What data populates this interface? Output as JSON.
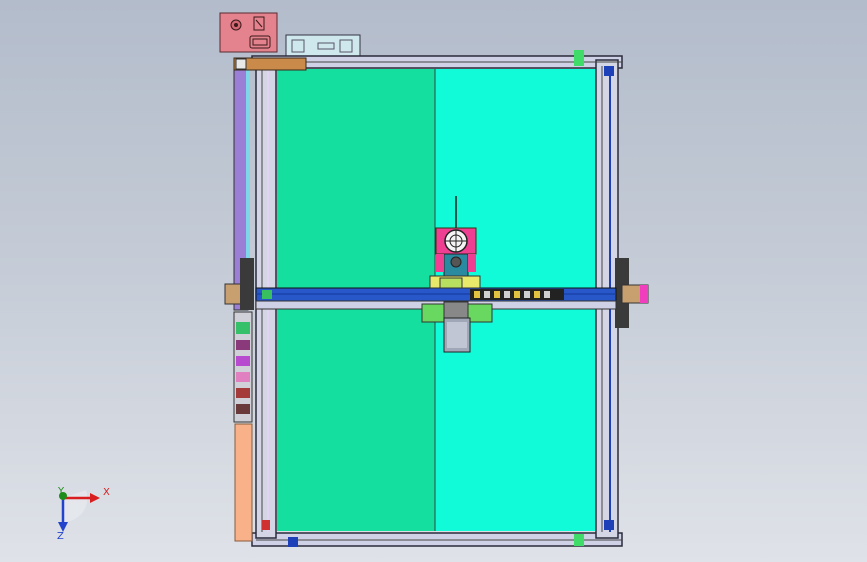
{
  "colors": {
    "background_top": "#b3bccb",
    "background_bottom": "#dfe2e8",
    "bed_left": "#14df9e",
    "bed_right": "#12fbd8",
    "frame": "#2a2a3a",
    "gantry_bar": "#2757c8",
    "carriage_pink": "#ef3f93",
    "left_rail": "#9b7fd6",
    "bottom_left_block": "#f8b189",
    "control_box": "#e4828e",
    "psu_box": "#cfe8ee",
    "axis_x": "#d81e1e",
    "axis_y": "#1d8c1d",
    "axis_z": "#2244cc"
  },
  "triad": {
    "x_label": "X",
    "y_label": "Y",
    "z_label": "Z",
    "icon": "coordinate-triad-icon"
  }
}
